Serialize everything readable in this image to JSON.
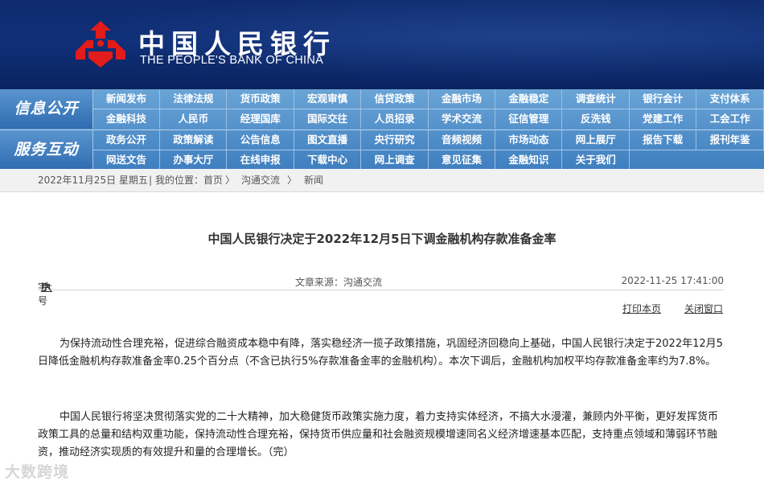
{
  "header": {
    "brand_cn": "中国人民银行",
    "brand_en": "THE PEOPLE'S BANK OF CHINA"
  },
  "nav": {
    "section1_title": "信息公开",
    "section1_row1": [
      "新闻发布",
      "法律法规",
      "货币政策",
      "宏观审慎",
      "信贷政策",
      "金融市场",
      "金融稳定",
      "调查统计",
      "银行会计",
      "支付体系"
    ],
    "section1_row2": [
      "金融科技",
      "人民币",
      "经理国库",
      "国际交往",
      "人员招录",
      "学术交流",
      "征信管理",
      "反洗钱",
      "党建工作",
      "工会工作"
    ],
    "section2_title": "服务互动",
    "section2_row1": [
      "政务公开",
      "政策解读",
      "公告信息",
      "图文直播",
      "央行研究",
      "音频视频",
      "市场动态",
      "网上展厅",
      "报告下载",
      "报刊年鉴"
    ],
    "section2_row2": [
      "网送文告",
      "办事大厅",
      "在线申报",
      "下载中心",
      "网上调查",
      "意见征集",
      "金融知识",
      "关于我们"
    ]
  },
  "breadcrumb": {
    "date": "2022年11月25日 星期五",
    "location_label": "我的位置：首页",
    "sep1": "〉",
    "level1": "沟通交流",
    "sep2": "〉",
    "level2": "新闻"
  },
  "article": {
    "title": "中国人民银行决定于2022年12月5日下调金融机构存款准备金率",
    "font_size_label": "字号",
    "font_large": "大",
    "font_medium": "中",
    "font_small": "小",
    "source": "文章来源：沟通交流",
    "datetime": "2022-11-25 17:41:00",
    "print_link": "打印本页",
    "close_link": "关闭窗口",
    "paragraph1": "为保持流动性合理充裕，促进综合融资成本稳中有降，落实稳经济一揽子政策措施，巩固经济回稳向上基础，中国人民银行决定于2022年12月5日降低金融机构存款准备金率0.25个百分点（不含已执行5%存款准备金率的金融机构）。本次下调后，金融机构加权平均存款准备金率约为7.8%。",
    "paragraph2": "中国人民银行将坚决贯彻落实党的二十大精神，加大稳健货币政策实施力度，着力支持实体经济，不搞大水漫灌，兼顾内外平衡，更好发挥货币政策工具的总量和结构双重功能，保持流动性合理充裕，保持货币供应量和社会融资规模增速同名义经济增速基本匹配，支持重点领域和薄弱环节融资，推动经济实现质的有效提升和量的合理增长。（完）"
  },
  "watermark": "大数跨境",
  "colors": {
    "header_bg": "#0f2f78",
    "nav_bg": "#4a88c8",
    "logo_red": "#e21b1b"
  }
}
